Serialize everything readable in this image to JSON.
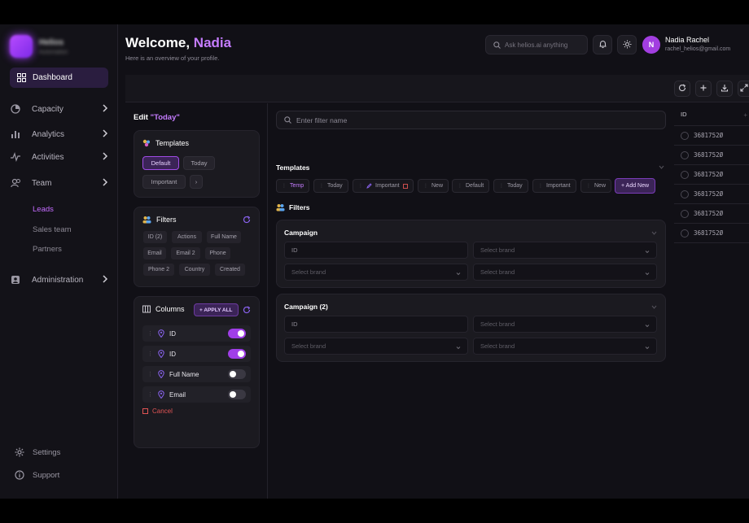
{
  "brand": {
    "name": "Helios",
    "subtitle": "Automation"
  },
  "nav": {
    "dashboard": "Dashboard",
    "capacity": "Capacity",
    "analytics": "Analytics",
    "activities": "Activities",
    "team": "Team",
    "leads": "Leads",
    "sales_team": "Sales team",
    "partners": "Partners",
    "administration": "Administration",
    "settings": "Settings",
    "support": "Support"
  },
  "header": {
    "welcome": "Welcome,",
    "user_first": "Nadia",
    "subtitle": "Here is an overview of your profile.",
    "search_placeholder": "Ask helios.ai anything",
    "user_name": "Nadia Rachel",
    "user_email": "rachel_helios@gmail.com",
    "avatar_initial": "N"
  },
  "edit": {
    "title_prefix": "Edit",
    "title_name": "\"Today\"",
    "templates": {
      "title": "Templates",
      "items": [
        "Default",
        "Today",
        "Important",
        "›"
      ]
    },
    "filters": {
      "title": "Filters",
      "tags": [
        "ID (2)",
        "Actions",
        "Full Name",
        "Email",
        "Email 2",
        "Phone",
        "Phone 2",
        "Country",
        "Created"
      ]
    },
    "columns": {
      "title": "Columns",
      "apply_all": "+ APPLY ALL",
      "rows": [
        {
          "label": "ID",
          "on": true
        },
        {
          "label": "ID",
          "on": true
        },
        {
          "label": "Full Name",
          "on": false
        },
        {
          "label": "Email",
          "on": false
        }
      ],
      "cancel": "Cancel"
    }
  },
  "filter_panel": {
    "name_placeholder": "Enter filter name",
    "templates_label": "Templates",
    "template_tabs": [
      "Temp",
      "Today",
      "Important",
      "New",
      "Default",
      "Today",
      "Important",
      "New"
    ],
    "add_new": "+ Add New",
    "filters_label": "Filters",
    "campaigns": [
      {
        "title": "Campaign",
        "fields": [
          "ID",
          "Select brand",
          "Select brand",
          "Select brand"
        ]
      },
      {
        "title": "Campaign (2)",
        "fields": [
          "ID",
          "Select brand",
          "Select brand",
          "Select brand"
        ]
      }
    ]
  },
  "table": {
    "header": "ID",
    "rows": [
      "3681752Ø",
      "3681752Ø",
      "3681752Ø",
      "3681752Ø",
      "3681752Ø",
      "3681752Ø"
    ]
  },
  "colors": {
    "accent": "#a03ee8",
    "accent_text": "#c57cff",
    "danger": "#e05454",
    "bg": "#111016"
  }
}
